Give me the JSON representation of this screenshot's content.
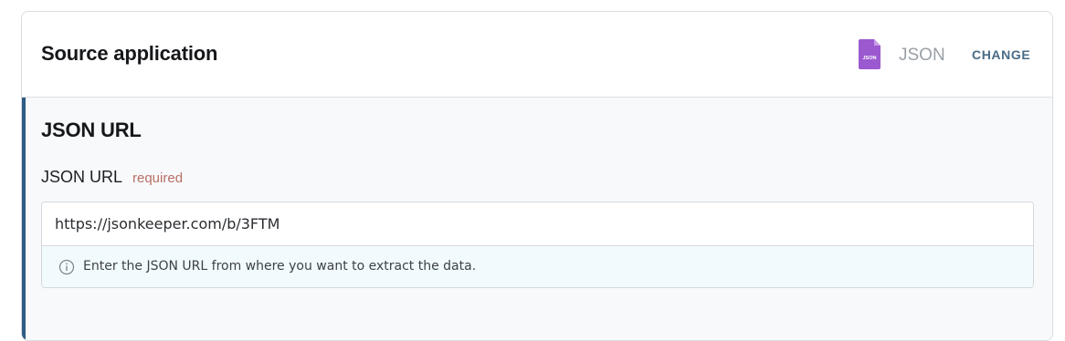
{
  "header": {
    "title": "Source application",
    "app_icon": "json-file-icon",
    "app_icon_text": "JSON",
    "app_icon_color": "#9b59d0",
    "app_name": "JSON",
    "change_label": "CHANGE"
  },
  "section": {
    "title": "JSON URL",
    "accent_color": "#2f5b86",
    "field": {
      "label": "JSON URL",
      "required_label": "required",
      "value": "https://jsonkeeper.com/b/3FTM",
      "help_icon": "info-icon",
      "help_text": "Enter the JSON URL from where you want to extract the data."
    }
  }
}
